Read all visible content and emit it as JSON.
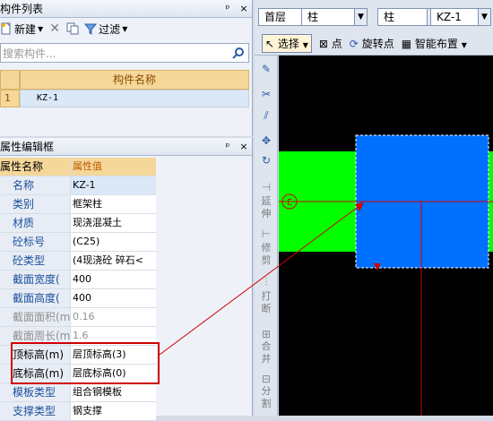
{
  "component_list": {
    "title": "构件列表",
    "pin": "ᵖ",
    "close": "×",
    "toolbar": {
      "new_label": "新建",
      "filter_label": "过滤"
    },
    "search_placeholder": "搜索构件...",
    "column_header": "构件名称",
    "rows": [
      {
        "index": "1",
        "name": "KZ-1"
      }
    ]
  },
  "property_editor": {
    "title": "属性编辑框",
    "header": {
      "name": "属性名称",
      "value": "属性值"
    },
    "rows": [
      {
        "name": "名称",
        "value": "KZ-1"
      },
      {
        "name": "类别",
        "value": "框架柱"
      },
      {
        "name": "材质",
        "value": "现浇混凝土"
      },
      {
        "name": "砼标号",
        "value": "(C25)"
      },
      {
        "name": "砼类型",
        "value": "(4现浇砼 碎石<"
      },
      {
        "name": "截面宽度(",
        "value": "400"
      },
      {
        "name": "截面高度(",
        "value": "400"
      },
      {
        "name": "截面面积(m",
        "value": "0.16"
      },
      {
        "name": "截面周长(m",
        "value": "1.6"
      },
      {
        "name": "顶标高(m)",
        "value": "层顶标高(3)"
      },
      {
        "name": "底标高(m)",
        "value": "层底标高(0)"
      },
      {
        "name": "模板类型",
        "value": "组合钢模板"
      },
      {
        "name": "支撑类型",
        "value": "钢支撑"
      }
    ]
  },
  "top_toolbar": {
    "floor": "首层",
    "type1": "柱",
    "type2": "柱",
    "component": "KZ-1",
    "select_label": "选择",
    "point_label": "点",
    "rotate_point_label": "旋转点",
    "smart_layout_label": "智能布置"
  },
  "vertical_tools": {
    "extend": "延伸",
    "trim": "修剪",
    "break": "打断",
    "merge": "合并",
    "split": "分割"
  },
  "canvas": {
    "axis_label": "E",
    "colors": {
      "background": "#000000",
      "wall": "#00ff00",
      "column": "#0070ff",
      "axis": "#d00000",
      "annotation": "#d00000"
    }
  }
}
